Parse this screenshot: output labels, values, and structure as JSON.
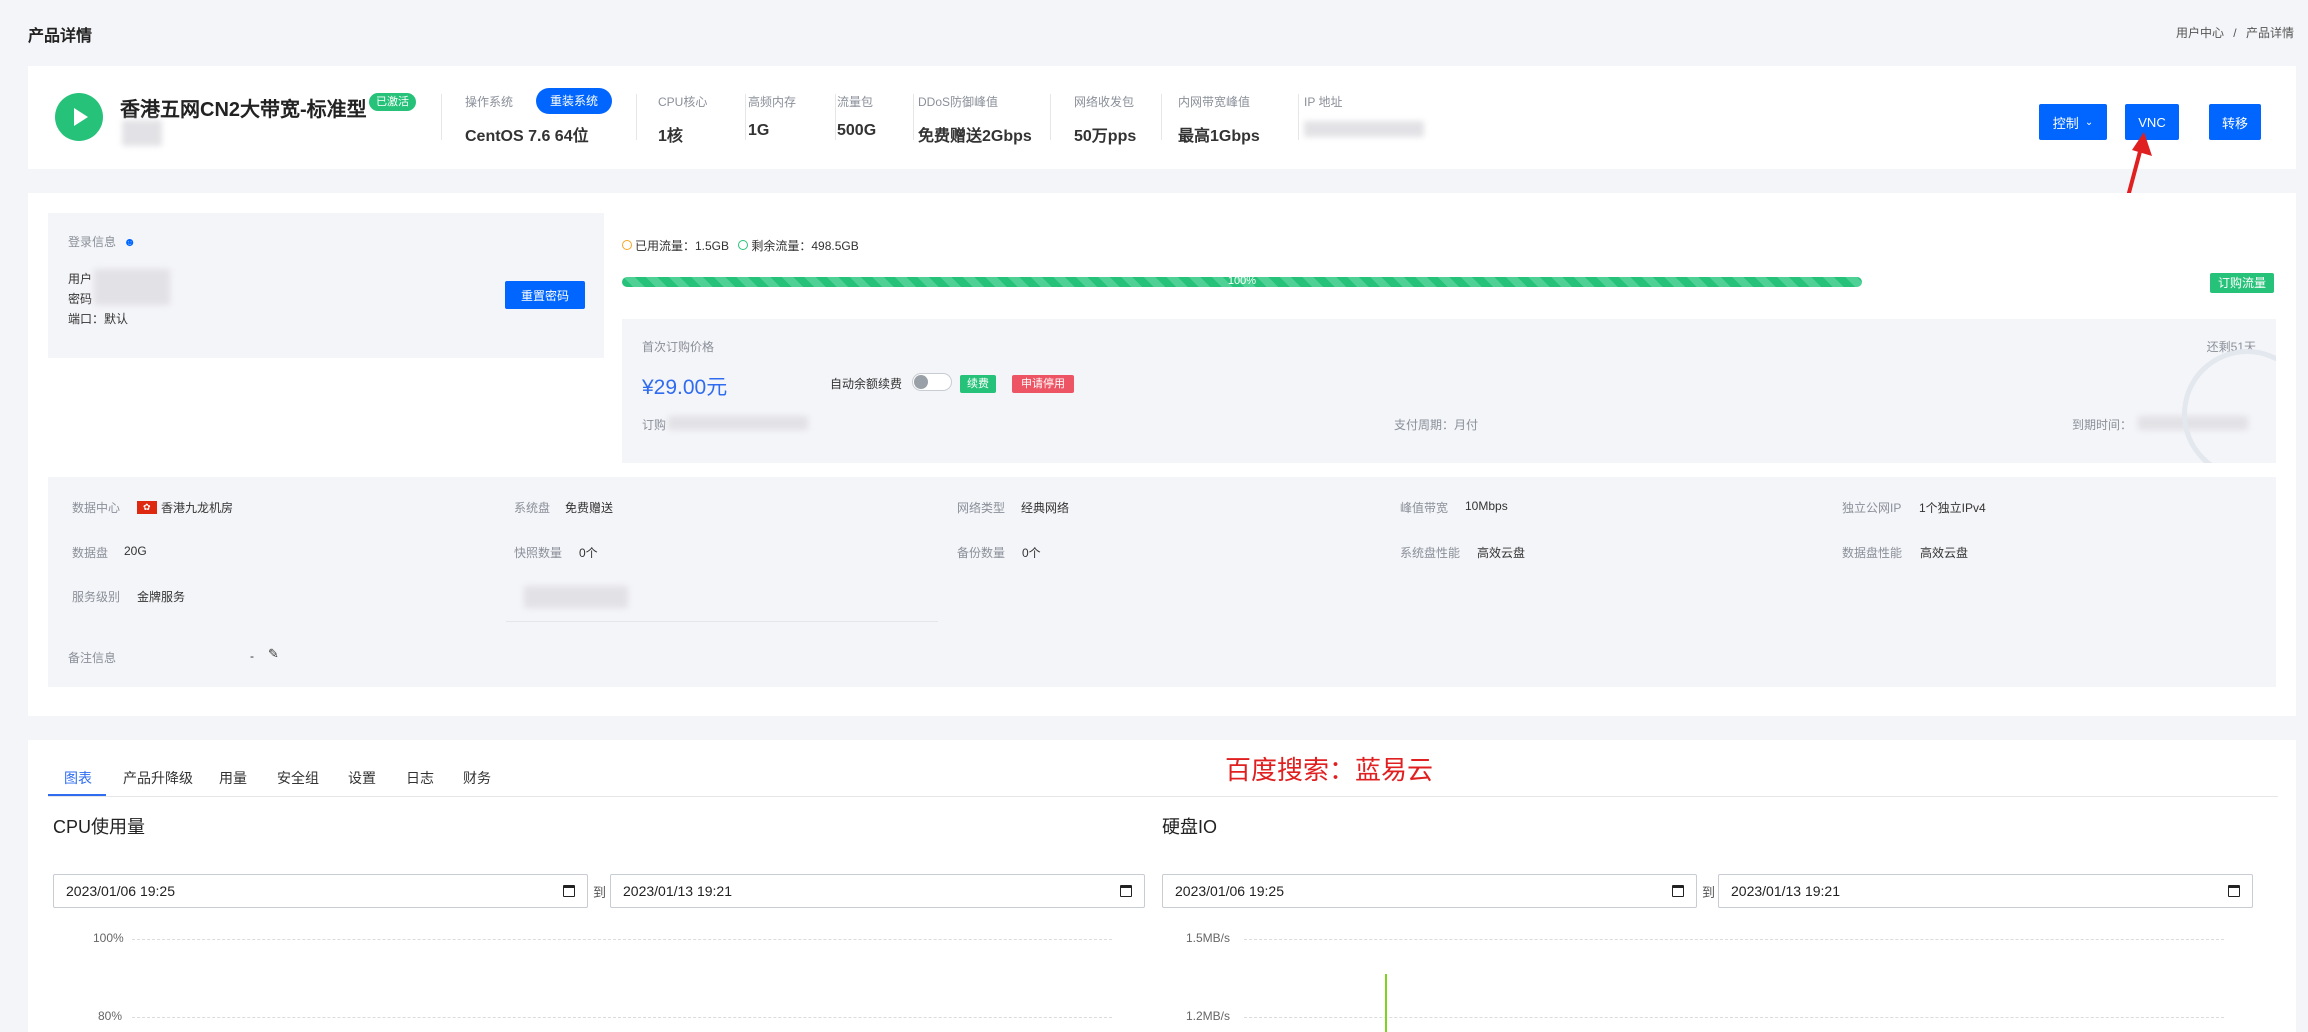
{
  "page": {
    "title": "产品详情",
    "breadcrumb": [
      "用户中心",
      "/",
      "产品详情"
    ]
  },
  "product": {
    "name": "香港五网CN2大带宽-标准型",
    "status_badge": "已激活",
    "specs": [
      {
        "label": "操作系统",
        "value": "CentOS 7.6 64位"
      },
      {
        "label": "CPU核心",
        "value": "1核"
      },
      {
        "label": "高频内存",
        "value": "1G"
      },
      {
        "label": "流量包",
        "value": "500G"
      },
      {
        "label": "DDoS防御峰值",
        "value": "免费赠送2Gbps"
      },
      {
        "label": "网络收发包",
        "value": "50万pps"
      },
      {
        "label": "内网带宽峰值",
        "value": "最高1Gbps"
      },
      {
        "label": "IP 地址",
        "value": ""
      }
    ],
    "reinstall_label": "重装系统",
    "actions": {
      "control": "控制",
      "vnc": "VNC",
      "migrate": "转移"
    }
  },
  "login": {
    "title": "登录信息",
    "user_label": "用户",
    "pass_label": "密码",
    "port_label": "端口：默认",
    "reset_button": "重置密码"
  },
  "traffic": {
    "used_label": "已用流量：1.5GB",
    "remain_label": "剩余流量：498.5GB",
    "progress_text": "100%",
    "progress_fraction": 1.0,
    "buy_button": "订购流量"
  },
  "billing": {
    "first_price_label": "首次订购价格",
    "remaining": "还剩51天",
    "price": "¥29.00元",
    "auto_renew_label": "自动余额续费",
    "auto_renew_on": false,
    "renew_button": "续费",
    "suspend_button": "申请停用",
    "order_label": "订购",
    "pay_cycle": "支付周期：月付",
    "expire_label": "到期时间："
  },
  "info_grid": [
    [
      {
        "label": "数据中心",
        "value": "香港九龙机房"
      },
      {
        "label": "系统盘",
        "value": "免费赠送"
      },
      {
        "label": "网络类型",
        "value": "经典网络"
      },
      {
        "label": "峰值带宽",
        "value": "10Mbps"
      },
      {
        "label": "独立公网IP",
        "value": "1个独立IPv4"
      }
    ],
    [
      {
        "label": "数据盘",
        "value": "20G"
      },
      {
        "label": "快照数量",
        "value": "0个"
      },
      {
        "label": "备份数量",
        "value": "0个"
      },
      {
        "label": "系统盘性能",
        "value": "高效云盘"
      },
      {
        "label": "数据盘性能",
        "value": "高效云盘"
      }
    ],
    [
      {
        "label": "服务级别",
        "value": "金牌服务"
      }
    ]
  ],
  "remark": {
    "label": "备注信息",
    "value": "-"
  },
  "tabs": [
    "图表",
    "产品升降级",
    "用量",
    "安全组",
    "设置",
    "日志",
    "财务"
  ],
  "watermark": "百度搜索：蓝易云",
  "charts": {
    "cpu": {
      "title": "CPU使用量",
      "from": "2023/01/06  19:25",
      "to": "2023/01/13  19:21",
      "sep": "到",
      "ticks": [
        "100%",
        "80%"
      ]
    },
    "disk": {
      "title": "硬盘IO",
      "from": "2023/01/06  19:25",
      "to": "2023/01/13  19:21",
      "sep": "到",
      "ticks": [
        "1.5MB/s",
        "1.2MB/s"
      ]
    }
  },
  "colors": {
    "primary": "#0066ff",
    "success": "#27c27a",
    "danger": "#ed5565",
    "accent_red": "#e02020"
  }
}
